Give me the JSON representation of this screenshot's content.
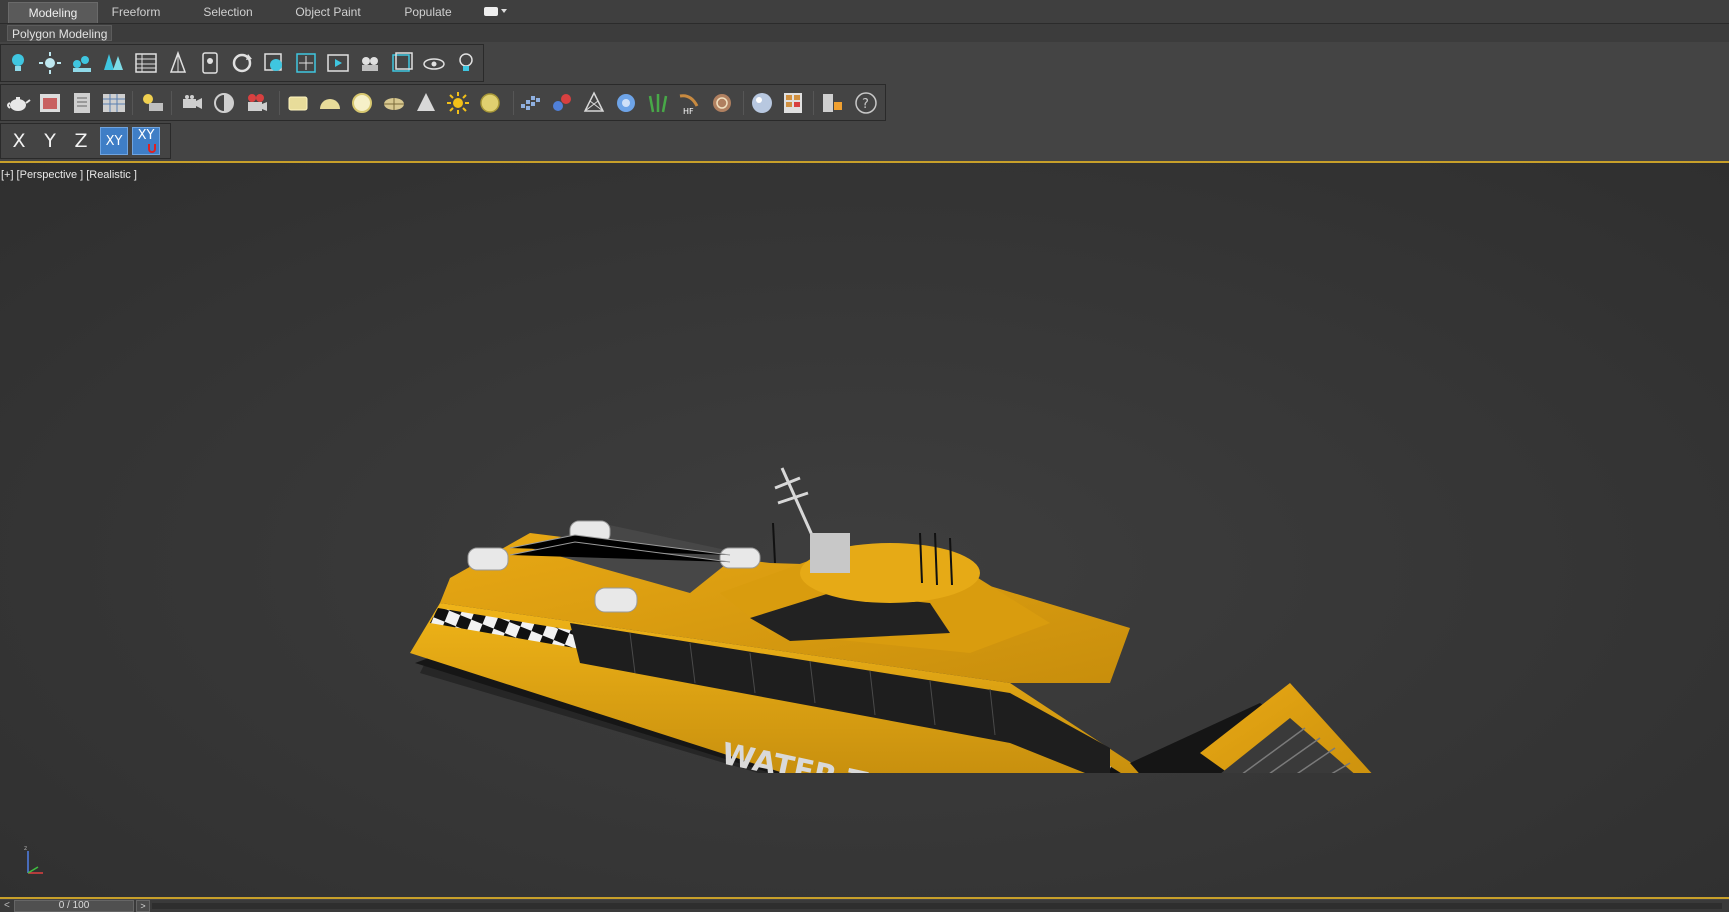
{
  "ribbon": {
    "tabs": [
      "Modeling",
      "Freeform",
      "Selection",
      "Object Paint",
      "Populate"
    ],
    "active_tab": "Modeling",
    "panel_title": "Polygon Modeling"
  },
  "axis_constraints": {
    "x": "X",
    "y": "Y",
    "z": "Z",
    "xy": "XY",
    "xy_snap": "XY"
  },
  "viewport": {
    "label_plus": "[+]",
    "label_view": "[Perspective ]",
    "label_shading": "[Realistic ]",
    "model_text": "WATER TAXI",
    "tripod_z": "z"
  },
  "timeline": {
    "left_arrow": "<",
    "frame": "0 / 100",
    "right_arrow": ">"
  },
  "colors": {
    "accent_blue": "#3f7ec6",
    "viewport_border": "#c8a02a",
    "hull_yellow": "#e0a412"
  }
}
